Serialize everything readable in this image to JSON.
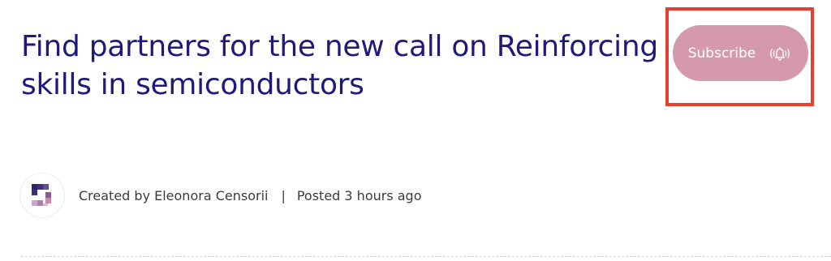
{
  "post": {
    "title": "Find partners for the new call on Reinforcing skills in semiconductors",
    "created_by": "Created by Eleonora Censorii",
    "separator": "|",
    "posted": "Posted 3 hours ago"
  },
  "subscribe": {
    "label": "Subscribe",
    "icon": "bell-ringing-icon"
  },
  "colors": {
    "title": "#1f1a7a",
    "subscribe_bg": "#d49aab",
    "highlight": "#e53f2e"
  }
}
